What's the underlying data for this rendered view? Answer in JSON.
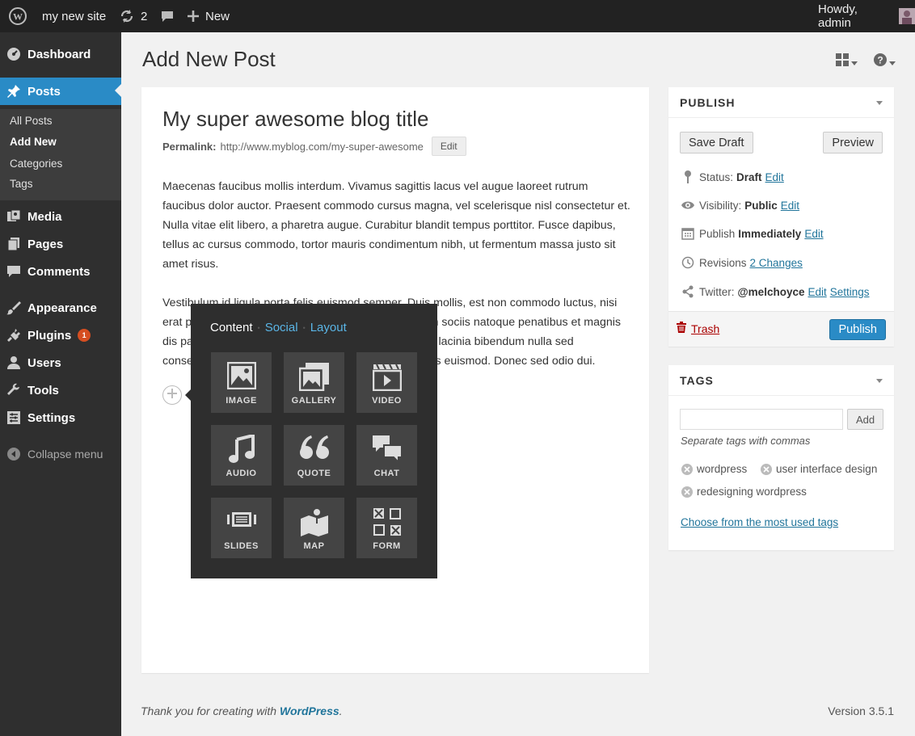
{
  "admin_bar": {
    "site_name": "my new site",
    "updates_count": "2",
    "new_label": "New",
    "greeting": "Howdy, admin"
  },
  "sidebar": {
    "items": [
      {
        "label": "Dashboard",
        "icon": "dashboard-icon"
      },
      {
        "label": "Posts",
        "icon": "pin-icon"
      },
      {
        "label": "Media",
        "icon": "media-icon"
      },
      {
        "label": "Pages",
        "icon": "pages-icon"
      },
      {
        "label": "Comments",
        "icon": "comments-icon"
      },
      {
        "label": "Appearance",
        "icon": "brush-icon"
      },
      {
        "label": "Plugins",
        "icon": "plug-icon",
        "badge": "1"
      },
      {
        "label": "Users",
        "icon": "users-icon"
      },
      {
        "label": "Tools",
        "icon": "wrench-icon"
      },
      {
        "label": "Settings",
        "icon": "settings-icon"
      }
    ],
    "submenu": [
      "All Posts",
      "Add New",
      "Categories",
      "Tags"
    ],
    "collapse_label": "Collapse menu"
  },
  "page": {
    "title": "Add New Post"
  },
  "editor": {
    "post_title": "My super awesome blog title",
    "permalink_label": "Permalink:",
    "permalink_url": "http://www.myblog.com/my-super-awesome",
    "edit_label": "Edit",
    "paragraph1": "Maecenas faucibus mollis interdum. Vivamus sagittis lacus vel augue laoreet rutrum faucibus dolor auctor. Praesent commodo cursus magna, vel scelerisque nisl consectetur et. Nulla vitae elit libero, a pharetra augue. Curabitur blandit tempus porttitor. Fusce dapibus, tellus ac cursus commodo, tortor mauris condimentum nibh, ut fermentum massa justo sit amet risus.",
    "paragraph2": "Vestibulum id ligula porta felis euismod semper. Duis mollis, est non commodo luctus, nisi erat porttitor ligula, eget lacinia odio sem nec elit. Cum sociis natoque penatibus et magnis dis parturient montes, nascetur ridiculus mus. Aenean lacinia bibendum nulla sed consectetur. Etiam porta sem malesuada magna mollis euismod. Donec sed odio dui. Maecenas sed diam eget risus varius blandit sit amet non magna."
  },
  "popover": {
    "tabs": [
      "Content",
      "Social",
      "Layout"
    ],
    "tiles": [
      {
        "label": "IMAGE",
        "icon": "image-icon"
      },
      {
        "label": "GALLERY",
        "icon": "gallery-icon"
      },
      {
        "label": "VIDEO",
        "icon": "video-icon"
      },
      {
        "label": "AUDIO",
        "icon": "audio-icon"
      },
      {
        "label": "QUOTE",
        "icon": "quote-icon"
      },
      {
        "label": "CHAT",
        "icon": "chat-icon"
      },
      {
        "label": "SLIDES",
        "icon": "slides-icon"
      },
      {
        "label": "MAP",
        "icon": "map-icon"
      },
      {
        "label": "FORM",
        "icon": "form-icon"
      }
    ]
  },
  "publish": {
    "heading": "PUBLISH",
    "save_draft": "Save Draft",
    "preview": "Preview",
    "status_label": "Status:",
    "status_value": "Draft",
    "visibility_label": "Visibility:",
    "visibility_value": "Public",
    "publish_label": "Publish",
    "publish_value": "Immediately",
    "revisions_label": "Revisions",
    "revisions_link": "2 Changes",
    "twitter_label": "Twitter:",
    "twitter_value": "@melchoyce",
    "edit_link": "Edit",
    "settings_link": "Settings",
    "trash": "Trash",
    "publish_button": "Publish"
  },
  "tags": {
    "heading": "TAGS",
    "input_value": "",
    "add_button": "Add",
    "hint": "Separate tags with commas",
    "items": [
      "wordpress",
      "user interface design",
      "redesigning wordpress"
    ],
    "most_used_link": "Choose from the most used tags"
  },
  "footer": {
    "thanks_prefix": "Thank you for creating with",
    "wordpress_link": "WordPress",
    "thanks_suffix": ".",
    "version": "Version 3.5.1"
  },
  "colors": {
    "accent": "#2a8bc6",
    "sidebar_bg": "#2f2f2f",
    "admin_bar_bg": "#222222",
    "link": "#21759b",
    "trash": "#aa0000",
    "badge": "#d54e21"
  }
}
